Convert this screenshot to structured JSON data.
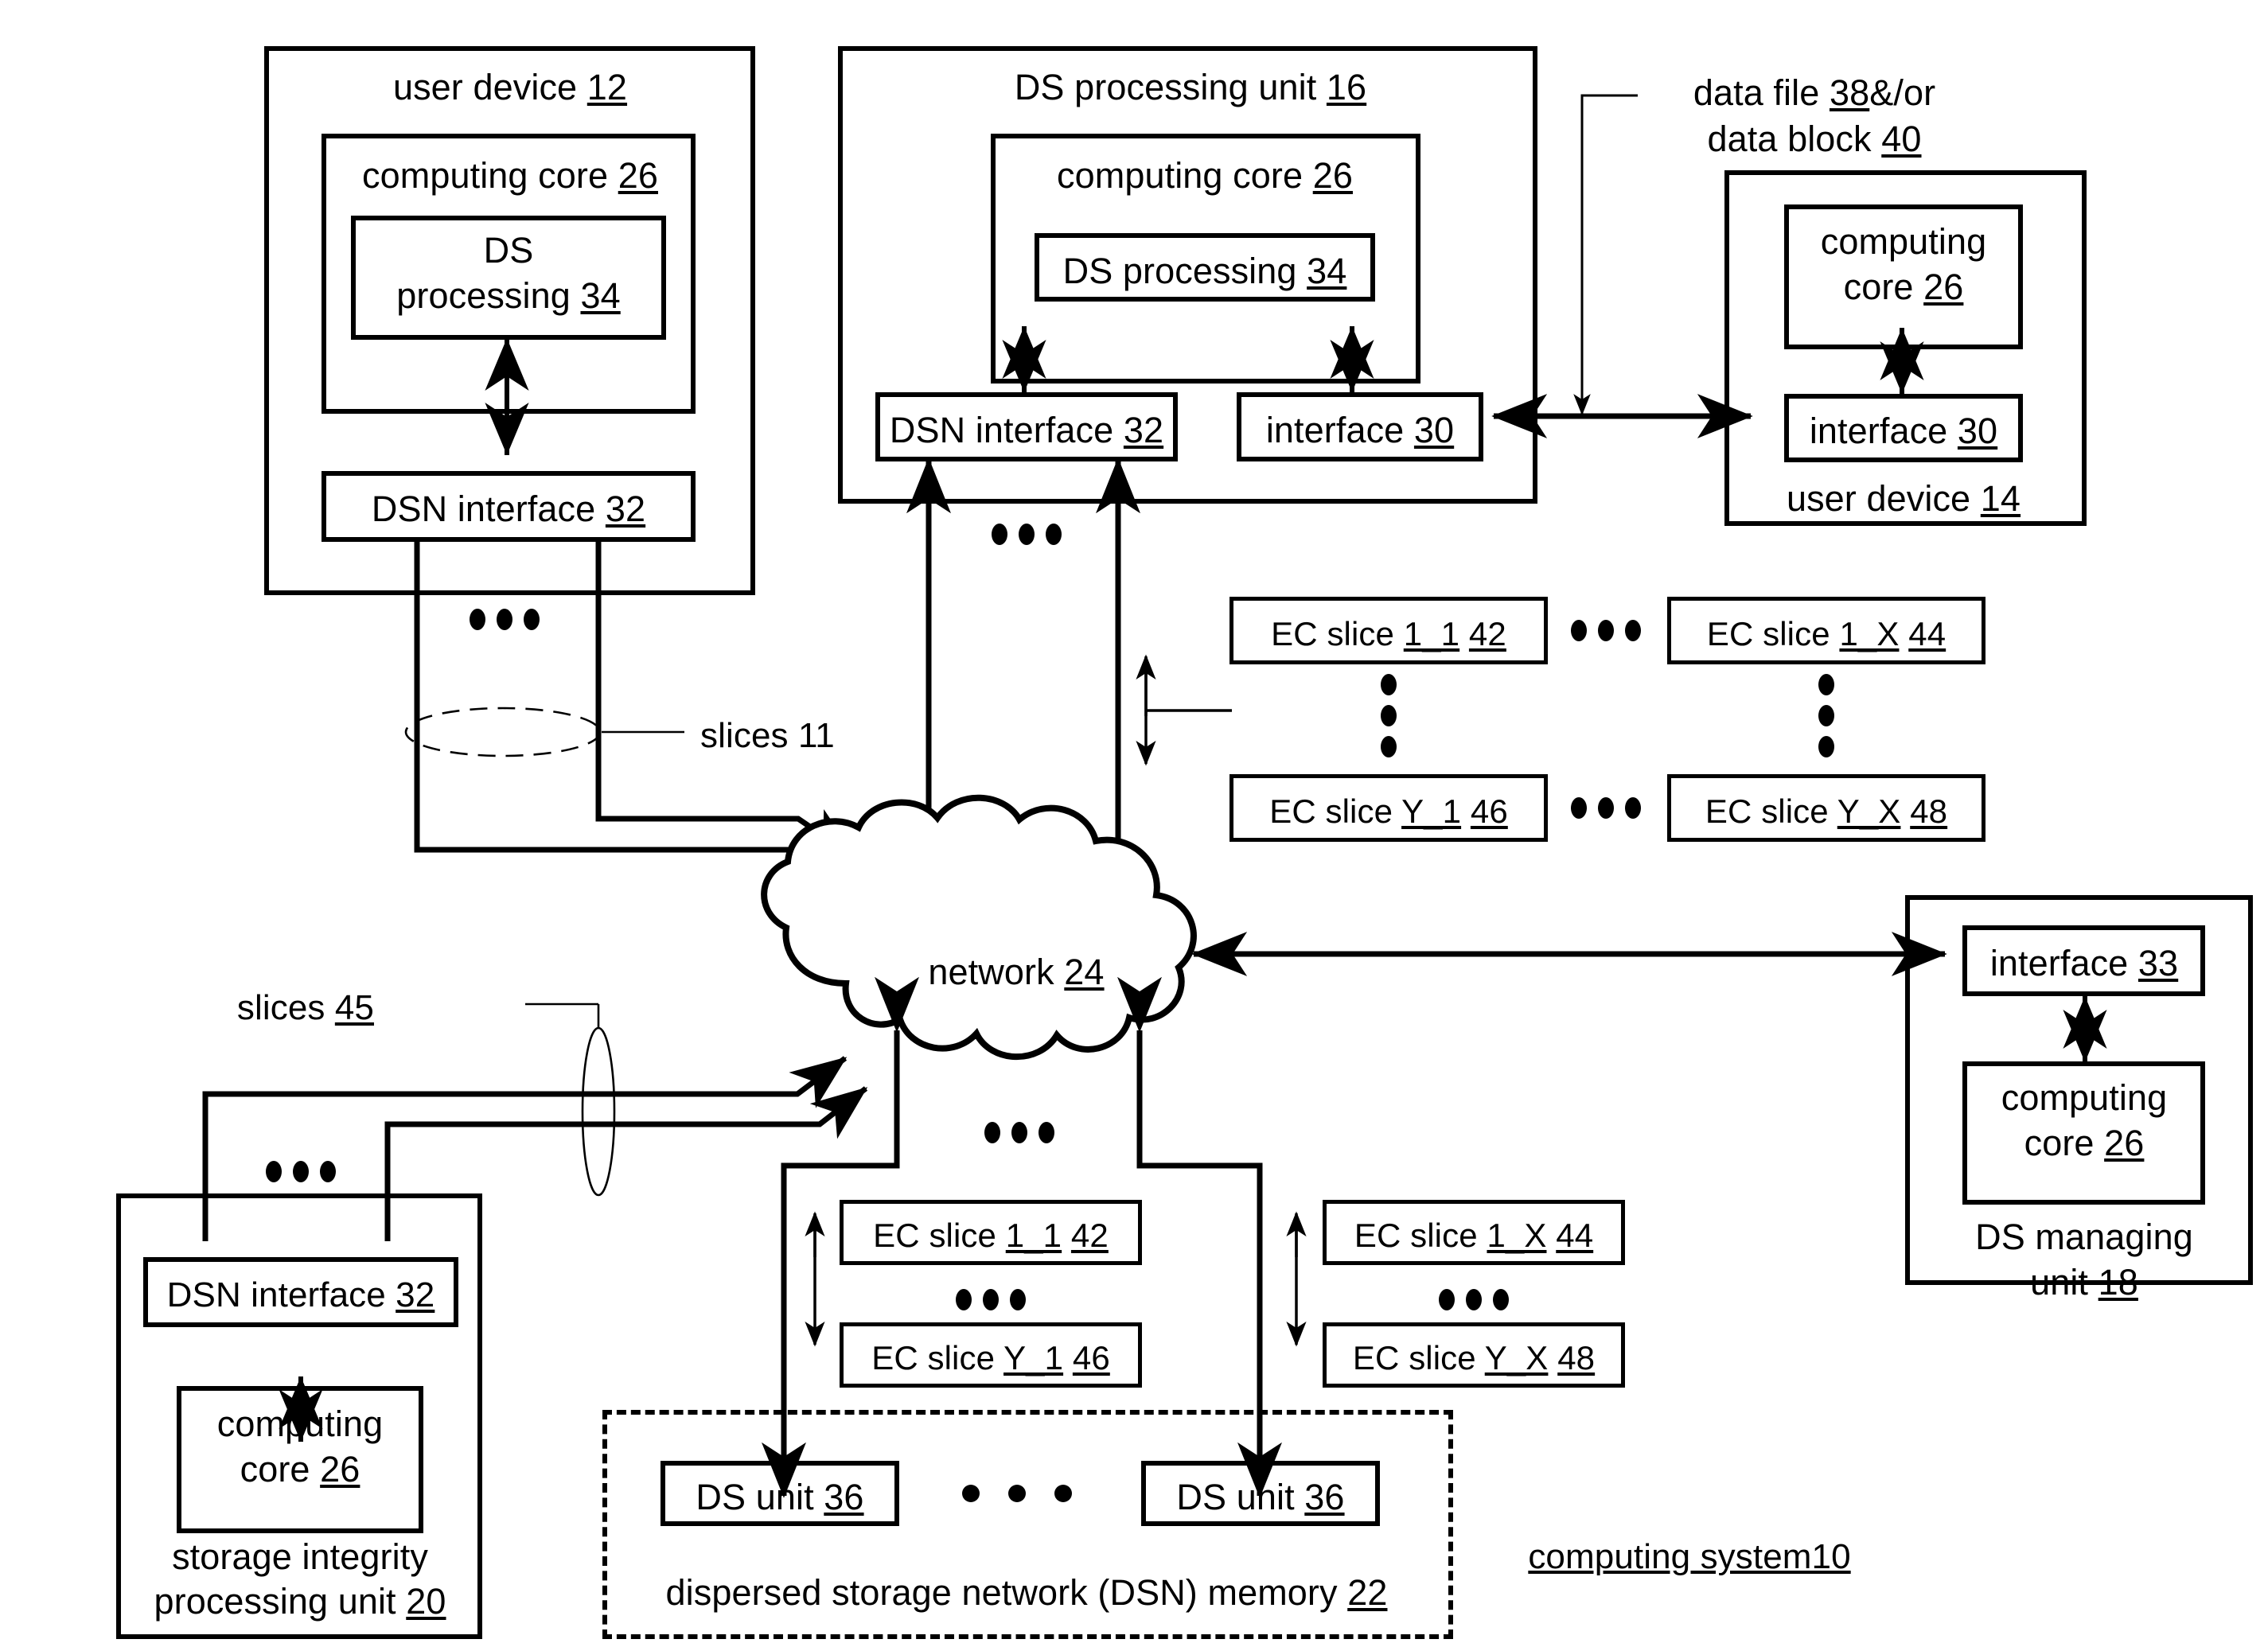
{
  "figure": {
    "system_label": "computing system10",
    "callout_data": [
      "data file 38&/or",
      "data block 40"
    ],
    "slices_top_label": "slices 11",
    "slices_bottom_label": "slices 45",
    "network_label": "network 24"
  },
  "user_device_12": {
    "title": "user device 12",
    "computing_core": "computing core 26",
    "ds_processing": [
      "DS",
      "processing 34"
    ],
    "dsn_interface": "DSN interface 32"
  },
  "ds_processing_unit_16": {
    "title": "DS processing unit 16",
    "computing_core": "computing core 26",
    "ds_processing": "DS processing 34",
    "dsn_interface": "DSN interface 32",
    "interface": "interface 30"
  },
  "user_device_14": {
    "title": "user device 14",
    "computing_core": [
      "computing",
      "core 26"
    ],
    "interface": "interface 30"
  },
  "ds_managing_unit_18": {
    "title": [
      "DS managing",
      "unit 18"
    ],
    "interface": "interface 33",
    "computing_core": [
      "computing",
      "core 26"
    ]
  },
  "storage_integrity_unit_20": {
    "title": [
      "storage integrity",
      "processing unit 20"
    ],
    "dsn_interface": "DSN interface 32",
    "computing_core": [
      "computing",
      "core 26"
    ]
  },
  "dsn_memory_22": {
    "title": "dispersed storage network (DSN) memory 22",
    "ds_units": [
      "DS unit 36",
      "DS unit 36"
    ]
  },
  "ec_slices_upper": {
    "top_left": "EC slice 1_1 42",
    "top_right": "EC slice 1_X 44",
    "bottom_left": "EC slice Y_1 46",
    "bottom_right": "EC slice Y_X 48"
  },
  "ec_slices_lower_left": {
    "top": "EC slice 1_1 42",
    "bottom": "EC slice Y_1 46"
  },
  "ec_slices_lower_right": {
    "top": "EC slice 1_X 44",
    "bottom": "EC slice Y_X 48"
  },
  "colors": {
    "stroke": "#000000",
    "background": "#ffffff"
  }
}
